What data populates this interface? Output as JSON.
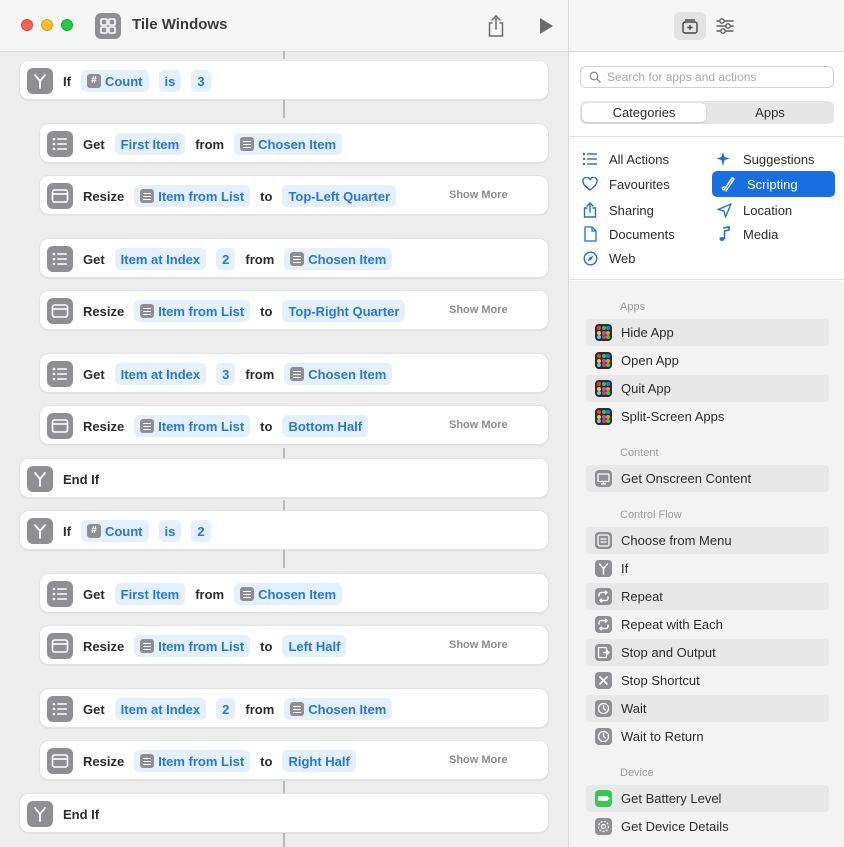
{
  "window": {
    "title": "Tile Windows"
  },
  "actions": [
    {
      "kind": "if",
      "label": "If",
      "var": "Count",
      "op": "is",
      "value": "3"
    },
    {
      "kind": "get",
      "label": "Get",
      "item": "First Item",
      "from": "from",
      "source": "Chosen Item"
    },
    {
      "kind": "resize",
      "label": "Resize",
      "item": "Item from List",
      "to": "to",
      "target": "Top-Left Quarter",
      "more": "Show More"
    },
    {
      "kind": "getidx",
      "label": "Get",
      "item": "Item at Index",
      "index": "2",
      "from": "from",
      "source": "Chosen Item"
    },
    {
      "kind": "resize",
      "label": "Resize",
      "item": "Item from List",
      "to": "to",
      "target": "Top-Right Quarter",
      "more": "Show More"
    },
    {
      "kind": "getidx",
      "label": "Get",
      "item": "Item at Index",
      "index": "3",
      "from": "from",
      "source": "Chosen Item"
    },
    {
      "kind": "resize",
      "label": "Resize",
      "item": "Item from List",
      "to": "to",
      "target": "Bottom Half",
      "more": "Show More"
    },
    {
      "kind": "endif",
      "label": "End If"
    },
    {
      "kind": "if",
      "label": "If",
      "var": "Count",
      "op": "is",
      "value": "2"
    },
    {
      "kind": "get",
      "label": "Get",
      "item": "First Item",
      "from": "from",
      "source": "Chosen Item"
    },
    {
      "kind": "resize",
      "label": "Resize",
      "item": "Item from List",
      "to": "to",
      "target": "Left Half",
      "more": "Show More"
    },
    {
      "kind": "getidx",
      "label": "Get",
      "item": "Item at Index",
      "index": "2",
      "from": "from",
      "source": "Chosen Item"
    },
    {
      "kind": "resize",
      "label": "Resize",
      "item": "Item from List",
      "to": "to",
      "target": "Right Half",
      "more": "Show More"
    },
    {
      "kind": "endif",
      "label": "End If"
    }
  ],
  "library": {
    "search_placeholder": "Search for apps and actions",
    "tabs": [
      "Categories",
      "Apps"
    ],
    "active_tab": "Categories",
    "categories": [
      {
        "label": "All Actions",
        "icon": "list-icon"
      },
      {
        "label": "Suggestions",
        "icon": "sparkles-icon"
      },
      {
        "label": "Favourites",
        "icon": "heart-icon"
      },
      {
        "label": "Scripting",
        "icon": "scroll-icon",
        "selected": true
      },
      {
        "label": "Sharing",
        "icon": "share-icon"
      },
      {
        "label": "Location",
        "icon": "location-arrow-icon"
      },
      {
        "label": "Documents",
        "icon": "document-icon"
      },
      {
        "label": "Media",
        "icon": "music-note-icon"
      },
      {
        "label": "Web",
        "icon": "compass-icon"
      }
    ],
    "sections": [
      {
        "title": "Apps",
        "items": [
          "Hide App",
          "Open App",
          "Quit App",
          "Split-Screen Apps"
        ]
      },
      {
        "title": "Content",
        "items": [
          "Get Onscreen Content"
        ]
      },
      {
        "title": "Control Flow",
        "items": [
          "Choose from Menu",
          "If",
          "Repeat",
          "Repeat with Each",
          "Stop and Output",
          "Stop Shortcut",
          "Wait",
          "Wait to Return"
        ]
      },
      {
        "title": "Device",
        "items": [
          "Get Battery Level",
          "Get Device Details"
        ]
      }
    ]
  },
  "colors": {
    "accent": "#1a6fe0",
    "token_text": "#2477e3",
    "token_bg": "#e5f0ff",
    "action_icon": "#8e8e93"
  }
}
